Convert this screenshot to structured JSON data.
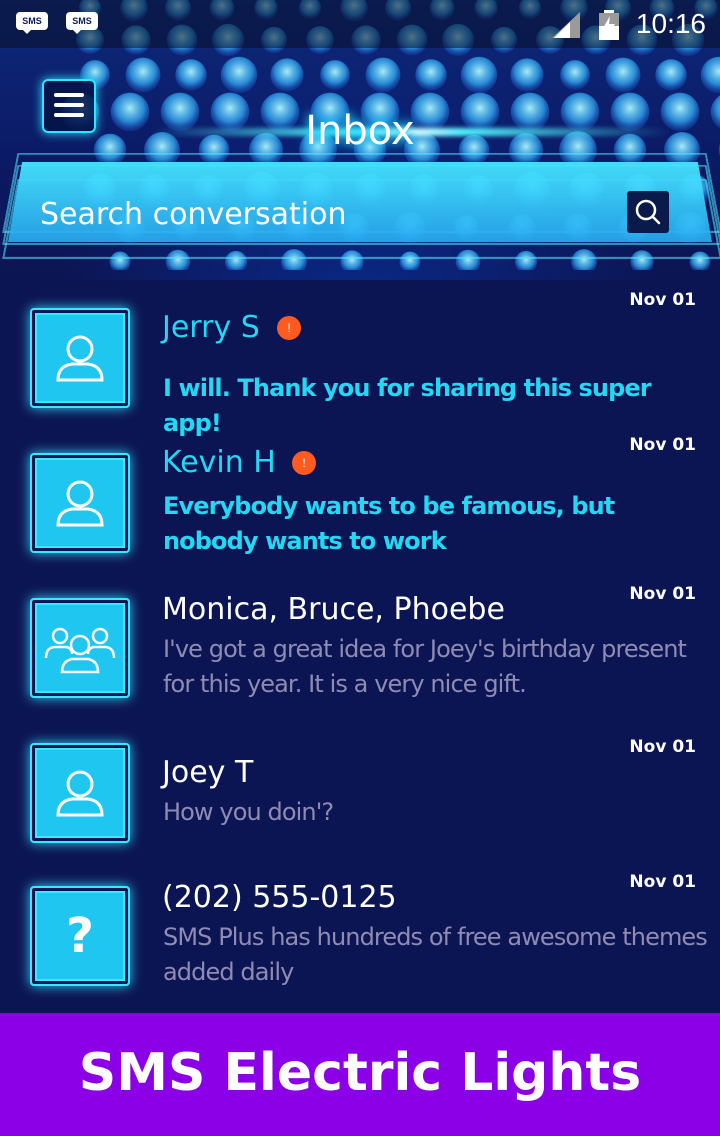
{
  "status_bar": {
    "time": "10:16",
    "notification_icons": [
      "sms-plus-icon",
      "sms-plus-icon"
    ],
    "icon_text": "SMS",
    "icons": [
      "signal-icon",
      "battery-icon"
    ]
  },
  "header": {
    "title": "Inbox",
    "menu_icon": "hamburger-menu-icon"
  },
  "search": {
    "placeholder": "Search conversation",
    "icon": "search-icon"
  },
  "conversations": [
    {
      "name": "Jerry S",
      "snippet": "I will. Thank you for sharing this super app!",
      "date": "Nov 01",
      "unread": true,
      "badge": "!",
      "avatar": "person-icon"
    },
    {
      "name": "Kevin H",
      "snippet": "Everybody wants to be famous, but nobody wants to work",
      "date": "Nov 01",
      "unread": true,
      "badge": "!",
      "avatar": "person-icon"
    },
    {
      "name": "Monica, Bruce, Phoebe",
      "snippet": "I've got a great idea for Joey's birthday present for this year. It is a very nice gift.",
      "date": "Nov 01",
      "unread": false,
      "avatar": "group-icon"
    },
    {
      "name": "Joey T",
      "snippet": "How you doin'?",
      "date": "Nov 01",
      "unread": false,
      "avatar": "person-icon"
    },
    {
      "name": "(202) 555-0125",
      "snippet": "SMS Plus has hundreds of free awesome themes added daily",
      "date": "Nov 01",
      "unread": false,
      "avatar": "unknown-contact-icon",
      "avatar_glyph": "?"
    }
  ],
  "footer": {
    "banner_text": "SMS Electric Lights"
  },
  "colors": {
    "background": "#0c1553",
    "accent_cyan": "#22d8f5",
    "badge_orange": "#ff5a1f",
    "footer_purple": "#8b00e6",
    "read_snippet": "#8f8bb3"
  }
}
